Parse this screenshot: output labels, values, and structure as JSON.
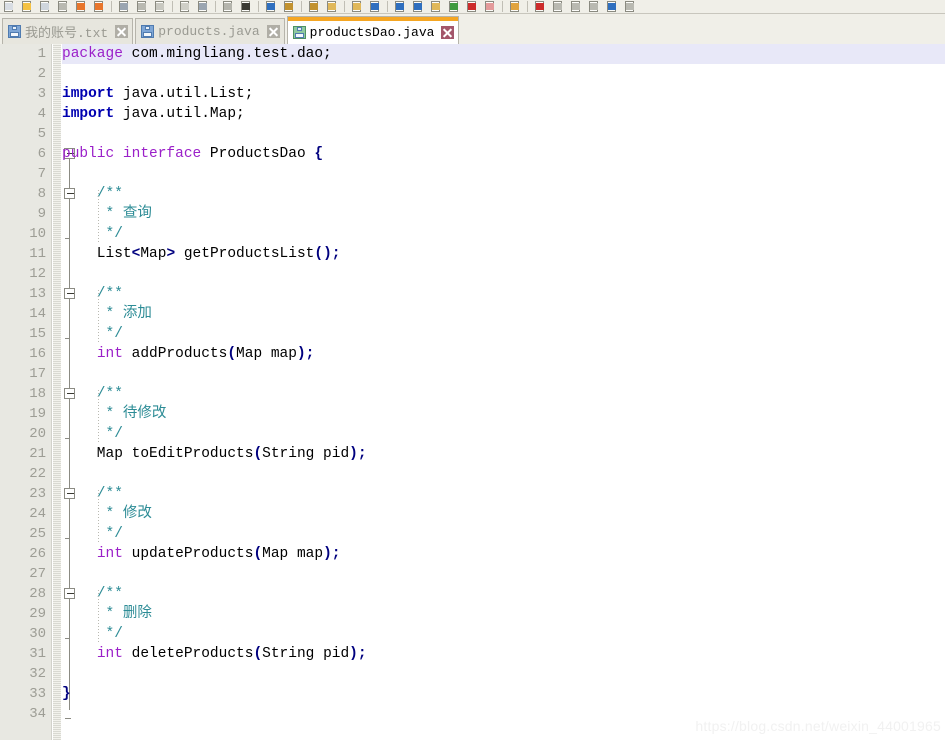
{
  "toolbar": {
    "icons": [
      "new-document-icon",
      "open-folder-icon",
      "save-icon",
      "save-all-icon",
      "close-document-icon",
      "close-all-documents-icon",
      "print-icon",
      "cut-icon",
      "copy-icon",
      "paste-icon",
      "undo-icon",
      "redo-icon",
      "find-icon",
      "replace-icon",
      "zoom-in-icon",
      "zoom-out-icon",
      "sync-scroll-vertical-icon",
      "sync-scroll-horizontal-icon",
      "word-wrap-icon",
      "show-all-characters-icon",
      "show-indent-guide-icon",
      "show-uppercase-icon",
      "macro-record-icon",
      "macro-stop-icon",
      "macro-playback-icon",
      "macro-save-icon",
      "run-icon",
      "start-macro-icon",
      "stop-macro-icon",
      "play-macro-icon",
      "multi-macro-icon",
      "document-map-icon"
    ]
  },
  "tabs": [
    {
      "label": "我的账号.txt",
      "name": "tab-wodezhanghao-txt",
      "active": false,
      "icon": "floppy-disk-icon",
      "close": "close-tab-icon"
    },
    {
      "label": "products.java",
      "name": "tab-products-java",
      "active": false,
      "icon": "floppy-disk-icon",
      "close": "close-tab-icon"
    },
    {
      "label": "productsDao.java",
      "name": "tab-productsdao-java",
      "active": true,
      "icon": "floppy-disk-icon",
      "close": "close-tab-icon"
    }
  ],
  "editor": {
    "active_line": 1,
    "total_lines": 34,
    "colors": {
      "keyword": "#9b20c9",
      "keyword_bold": "#0000b0",
      "comment": "#2d8c96",
      "punctuation": "#00007f",
      "plain": "#000000",
      "gutter_bg": "#e8e8e2",
      "line_number": "#9d9d95",
      "active_line_bg": "#e8e8f8",
      "active_tab_accent": "#f5a623"
    },
    "lines": [
      {
        "n": "1",
        "tokens": [
          {
            "t": "package",
            "c": "kw"
          },
          {
            "t": " com.mingliang.test.dao;",
            "c": "plain"
          }
        ]
      },
      {
        "n": "2",
        "tokens": []
      },
      {
        "n": "3",
        "tokens": [
          {
            "t": "import",
            "c": "kwb"
          },
          {
            "t": " java.util.List;",
            "c": "plain"
          }
        ]
      },
      {
        "n": "4",
        "tokens": [
          {
            "t": "import",
            "c": "kwb"
          },
          {
            "t": " java.util.Map;",
            "c": "plain"
          }
        ]
      },
      {
        "n": "5",
        "tokens": []
      },
      {
        "n": "6",
        "tokens": [
          {
            "t": "public interface",
            "c": "kw"
          },
          {
            "t": " ProductsDao ",
            "c": "plain"
          },
          {
            "t": "{",
            "c": "punc"
          }
        ]
      },
      {
        "n": "7",
        "tokens": []
      },
      {
        "n": "8",
        "tokens": [
          {
            "t": "    /**",
            "c": "cmt"
          }
        ]
      },
      {
        "n": "9",
        "tokens": [
          {
            "t": "     * 查询",
            "c": "cmt"
          }
        ]
      },
      {
        "n": "10",
        "tokens": [
          {
            "t": "     */",
            "c": "cmt"
          }
        ]
      },
      {
        "n": "11",
        "tokens": [
          {
            "t": "    List",
            "c": "plain"
          },
          {
            "t": "<",
            "c": "punc"
          },
          {
            "t": "Map",
            "c": "plain"
          },
          {
            "t": ">",
            "c": "punc"
          },
          {
            "t": " getProductsList",
            "c": "plain"
          },
          {
            "t": "();",
            "c": "punc"
          }
        ]
      },
      {
        "n": "12",
        "tokens": []
      },
      {
        "n": "13",
        "tokens": [
          {
            "t": "    /**",
            "c": "cmt"
          }
        ]
      },
      {
        "n": "14",
        "tokens": [
          {
            "t": "     * 添加",
            "c": "cmt"
          }
        ]
      },
      {
        "n": "15",
        "tokens": [
          {
            "t": "     */",
            "c": "cmt"
          }
        ]
      },
      {
        "n": "16",
        "tokens": [
          {
            "t": "    ",
            "c": "plain"
          },
          {
            "t": "int",
            "c": "kw"
          },
          {
            "t": " addProducts",
            "c": "plain"
          },
          {
            "t": "(",
            "c": "punc"
          },
          {
            "t": "Map map",
            "c": "plain"
          },
          {
            "t": ");",
            "c": "punc"
          }
        ]
      },
      {
        "n": "17",
        "tokens": []
      },
      {
        "n": "18",
        "tokens": [
          {
            "t": "    /**",
            "c": "cmt"
          }
        ]
      },
      {
        "n": "19",
        "tokens": [
          {
            "t": "     * 待修改",
            "c": "cmt"
          }
        ]
      },
      {
        "n": "20",
        "tokens": [
          {
            "t": "     */",
            "c": "cmt"
          }
        ]
      },
      {
        "n": "21",
        "tokens": [
          {
            "t": "    Map toEditProducts",
            "c": "plain"
          },
          {
            "t": "(",
            "c": "punc"
          },
          {
            "t": "String pid",
            "c": "plain"
          },
          {
            "t": ");",
            "c": "punc"
          }
        ]
      },
      {
        "n": "22",
        "tokens": []
      },
      {
        "n": "23",
        "tokens": [
          {
            "t": "    /**",
            "c": "cmt"
          }
        ]
      },
      {
        "n": "24",
        "tokens": [
          {
            "t": "     * 修改",
            "c": "cmt"
          }
        ]
      },
      {
        "n": "25",
        "tokens": [
          {
            "t": "     */",
            "c": "cmt"
          }
        ]
      },
      {
        "n": "26",
        "tokens": [
          {
            "t": "    ",
            "c": "plain"
          },
          {
            "t": "int",
            "c": "kw"
          },
          {
            "t": " updateProducts",
            "c": "plain"
          },
          {
            "t": "(",
            "c": "punc"
          },
          {
            "t": "Map map",
            "c": "plain"
          },
          {
            "t": ");",
            "c": "punc"
          }
        ]
      },
      {
        "n": "27",
        "tokens": []
      },
      {
        "n": "28",
        "tokens": [
          {
            "t": "    /**",
            "c": "cmt"
          }
        ]
      },
      {
        "n": "29",
        "tokens": [
          {
            "t": "     * 删除",
            "c": "cmt"
          }
        ]
      },
      {
        "n": "30",
        "tokens": [
          {
            "t": "     */",
            "c": "cmt"
          }
        ]
      },
      {
        "n": "31",
        "tokens": [
          {
            "t": "    ",
            "c": "plain"
          },
          {
            "t": "int",
            "c": "kw"
          },
          {
            "t": " deleteProducts",
            "c": "plain"
          },
          {
            "t": "(",
            "c": "punc"
          },
          {
            "t": "String pid",
            "c": "plain"
          },
          {
            "t": ");",
            "c": "punc"
          }
        ]
      },
      {
        "n": "32",
        "tokens": []
      },
      {
        "n": "33",
        "tokens": [
          {
            "t": "}",
            "c": "punc"
          }
        ]
      },
      {
        "n": "34",
        "tokens": []
      }
    ],
    "fold_markers": [
      6,
      8,
      13,
      18,
      23,
      28
    ],
    "fold_end_ticks": [
      10,
      15,
      20,
      25,
      30,
      34
    ]
  },
  "watermark": {
    "text": "https://blog.csdn.net/weixin_44001965"
  }
}
